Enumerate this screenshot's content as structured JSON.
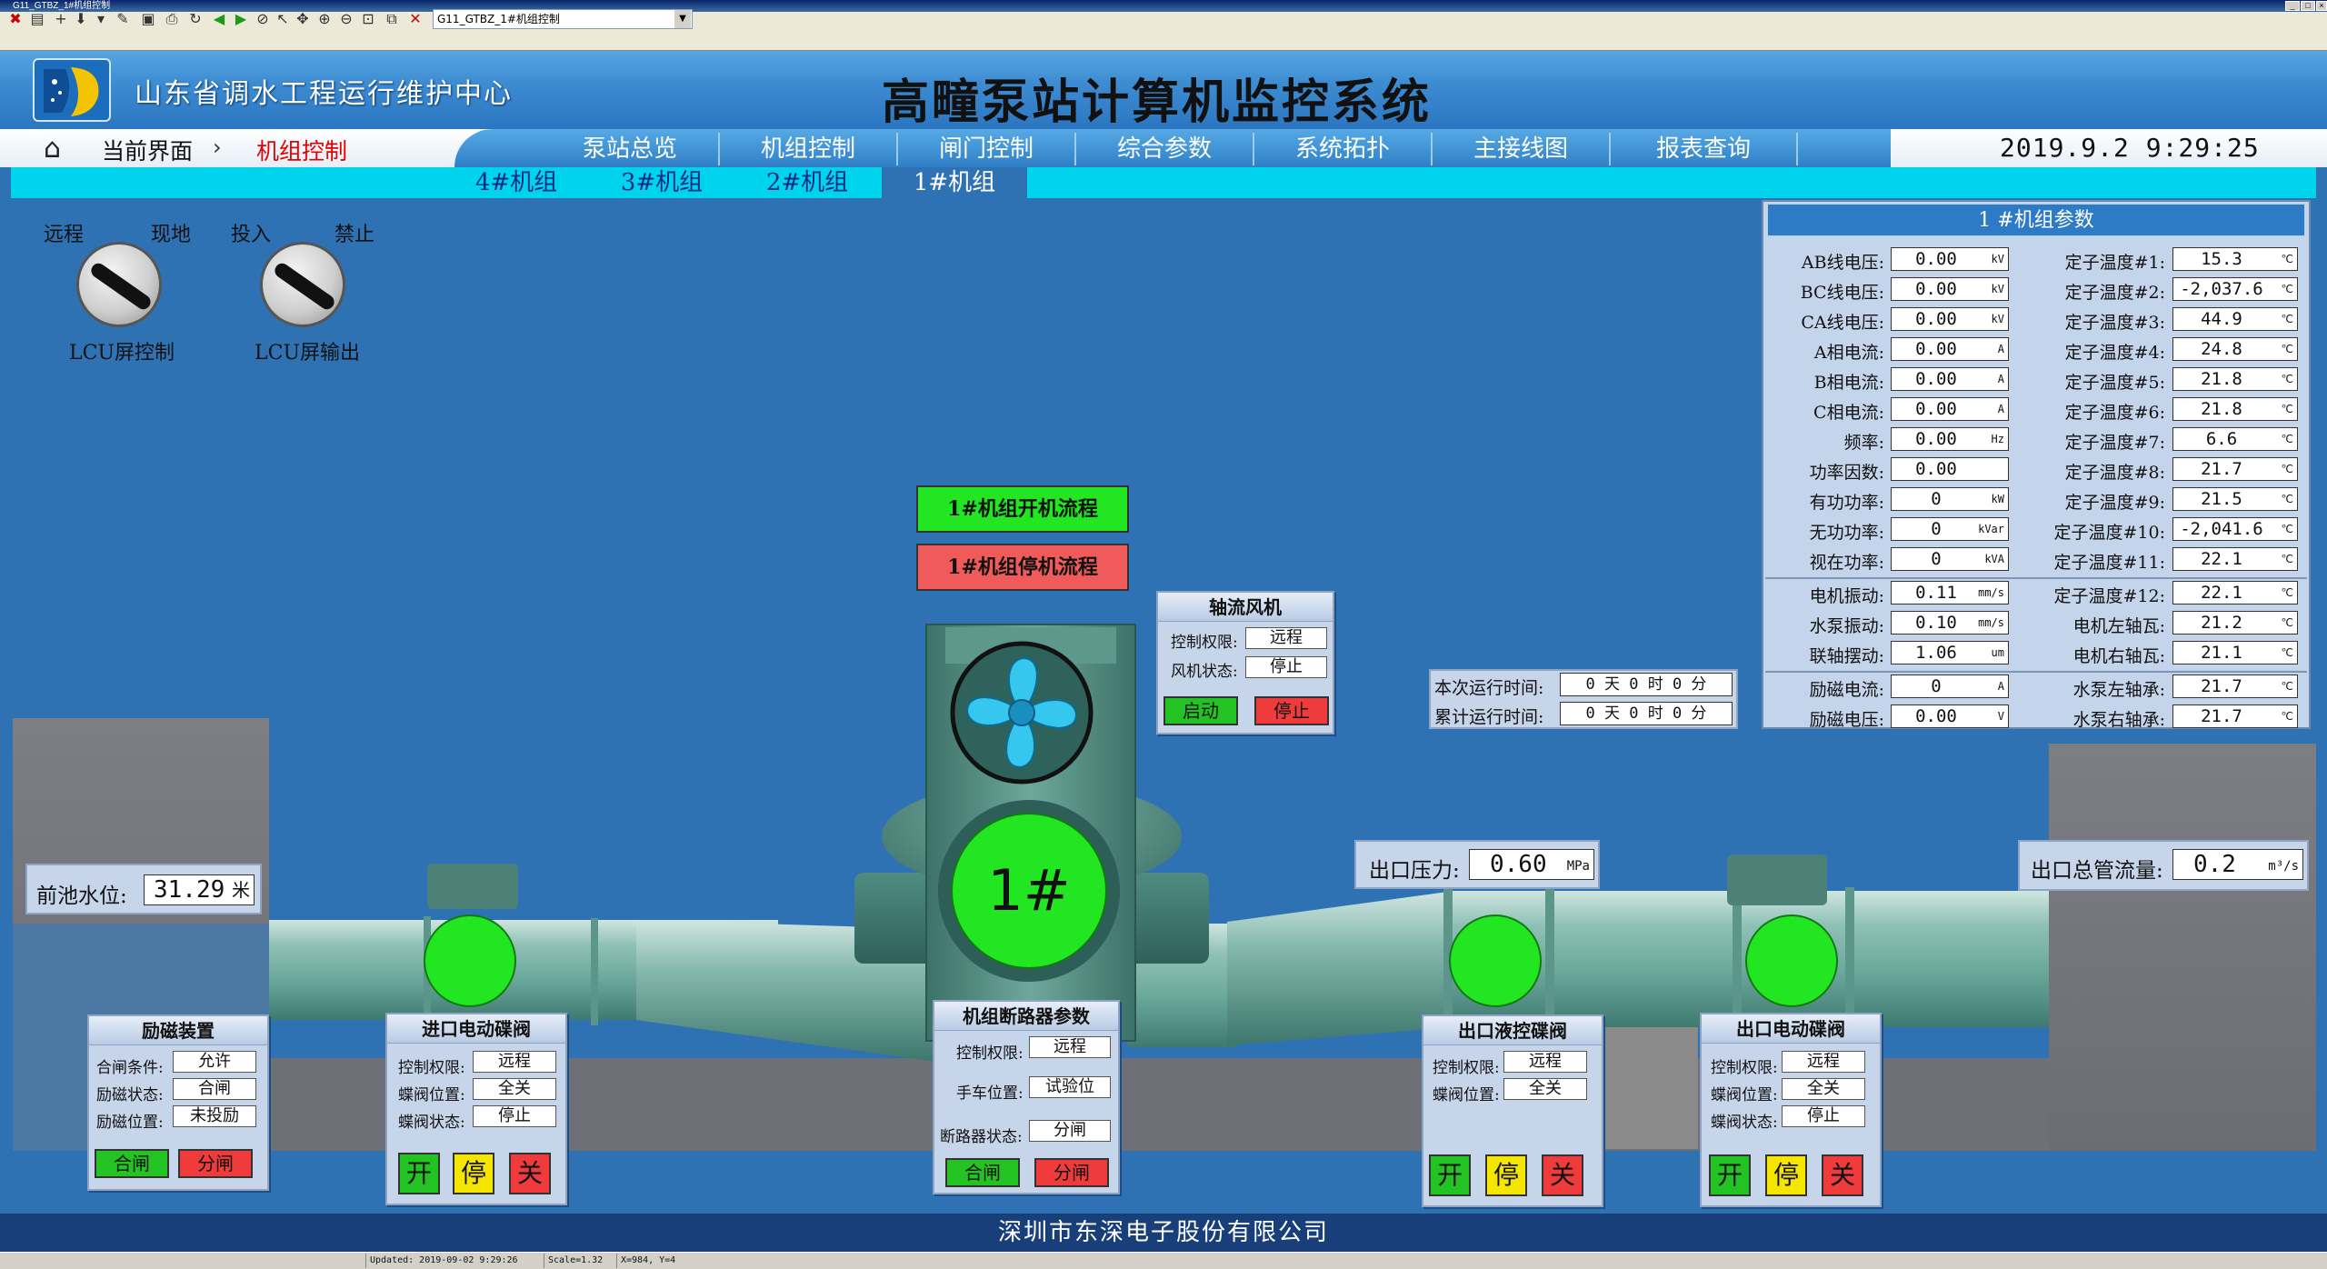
{
  "window": {
    "title": "G11_GTBZ_1#机组控制",
    "address": "G11_GTBZ_1#机组控制"
  },
  "header": {
    "org": "山东省调水工程运行维护中心",
    "system_title": "高疃泵站计算机监控系统"
  },
  "breadcrumb": {
    "current_label": "当前界面",
    "page": "机组控制"
  },
  "nav": {
    "items": [
      "泵站总览",
      "机组控制",
      "闸门控制",
      "综合参数",
      "系统拓扑",
      "主接线图",
      "报表查询"
    ]
  },
  "datetime": "2019.9.2  9:29:25",
  "unit_tabs": [
    "4#机组",
    "3#机组",
    "2#机组",
    "1#机组"
  ],
  "switches": {
    "lcu_control": {
      "left": "远程",
      "right": "现地",
      "caption": "LCU屏控制"
    },
    "lcu_output": {
      "left": "投入",
      "right": "禁止",
      "caption": "LCU屏输出"
    }
  },
  "flow": {
    "start": "1#机组开机流程",
    "stop": "1#机组停机流程"
  },
  "unit_label": "1#",
  "fan": {
    "title": "轴流风机",
    "auth_label": "控制权限:",
    "auth": "远程",
    "state_label": "风机状态:",
    "state": "停止",
    "start": "启动",
    "stop": "停止"
  },
  "runtime": {
    "current_label": "本次运行时间:",
    "current": "0 天 0 时 0 分",
    "total_label": "累计运行时间:",
    "total": "0 天 0 时 0 分"
  },
  "readouts": {
    "forebay": {
      "label": "前池水位:",
      "value": "31.29",
      "unit": "米"
    },
    "outlet_pressure": {
      "label": "出口压力:",
      "value": "0.60",
      "unit": "MPa"
    },
    "outlet_flow": {
      "label": "出口总管流量:",
      "value": "0.2",
      "unit": "m³/s"
    }
  },
  "excitation": {
    "title": "励磁装置",
    "rows": [
      {
        "label": "合闸条件:",
        "value": "允许"
      },
      {
        "label": "励磁状态:",
        "value": "合闸"
      },
      {
        "label": "励磁位置:",
        "value": "未投励"
      }
    ],
    "btn_close": "合闸",
    "btn_open": "分闸"
  },
  "inlet_valve": {
    "title": "进口电动碟阀",
    "rows": [
      {
        "label": "控制权限:",
        "value": "远程"
      },
      {
        "label": "蝶阀位置:",
        "value": "全关"
      },
      {
        "label": "蝶阀状态:",
        "value": "停止"
      }
    ],
    "btn_open": "开",
    "btn_stop": "停",
    "btn_close": "关"
  },
  "breaker": {
    "title": "机组断路器参数",
    "rows": [
      {
        "label": "控制权限:",
        "value": "远程"
      },
      {
        "label": "手车位置:",
        "value": "试验位"
      },
      {
        "label": "断路器状态:",
        "value": "分闸"
      }
    ],
    "btn_close": "合闸",
    "btn_open": "分闸"
  },
  "outlet_hyd_valve": {
    "title": "出口液控碟阀",
    "rows": [
      {
        "label": "控制权限:",
        "value": "远程"
      },
      {
        "label": "蝶阀位置:",
        "value": "全关"
      }
    ],
    "btn_open": "开",
    "btn_stop": "停",
    "btn_close": "关"
  },
  "outlet_elec_valve": {
    "title": "出口电动碟阀",
    "rows": [
      {
        "label": "控制权限:",
        "value": "远程"
      },
      {
        "label": "蝶阀位置:",
        "value": "全关"
      },
      {
        "label": "蝶阀状态:",
        "value": "停止"
      }
    ],
    "btn_open": "开",
    "btn_stop": "停",
    "btn_close": "关"
  },
  "params": {
    "title": "1 #机组参数",
    "left": [
      {
        "label": "AB线电压:",
        "value": "0.00",
        "unit": "kV"
      },
      {
        "label": "BC线电压:",
        "value": "0.00",
        "unit": "kV"
      },
      {
        "label": "CA线电压:",
        "value": "0.00",
        "unit": "kV"
      },
      {
        "label": "A相电流:",
        "value": "0.00",
        "unit": "A"
      },
      {
        "label": "B相电流:",
        "value": "0.00",
        "unit": "A"
      },
      {
        "label": "C相电流:",
        "value": "0.00",
        "unit": "A"
      },
      {
        "label": "频率:",
        "value": "0.00",
        "unit": "Hz"
      },
      {
        "label": "功率因数:",
        "value": "0.00",
        "unit": ""
      },
      {
        "label": "有功功率:",
        "value": "0",
        "unit": "kW"
      },
      {
        "label": "无功功率:",
        "value": "0",
        "unit": "kVar"
      },
      {
        "label": "视在功率:",
        "value": "0",
        "unit": "kVA"
      },
      {
        "label": "电机振动:",
        "value": "0.11",
        "unit": "mm/s"
      },
      {
        "label": "水泵振动:",
        "value": "0.10",
        "unit": "mm/s"
      },
      {
        "label": "联轴摆动:",
        "value": "1.06",
        "unit": "um"
      },
      {
        "label": "励磁电流:",
        "value": "0",
        "unit": "A"
      },
      {
        "label": "励磁电压:",
        "value": "0.00",
        "unit": "V"
      }
    ],
    "right": [
      {
        "label": "定子温度#1:",
        "value": "15.3",
        "unit": "℃"
      },
      {
        "label": "定子温度#2:",
        "value": "-2,037.6",
        "unit": "℃"
      },
      {
        "label": "定子温度#3:",
        "value": "44.9",
        "unit": "℃"
      },
      {
        "label": "定子温度#4:",
        "value": "24.8",
        "unit": "℃"
      },
      {
        "label": "定子温度#5:",
        "value": "21.8",
        "unit": "℃"
      },
      {
        "label": "定子温度#6:",
        "value": "21.8",
        "unit": "℃"
      },
      {
        "label": "定子温度#7:",
        "value": "6.6",
        "unit": "℃"
      },
      {
        "label": "定子温度#8:",
        "value": "21.7",
        "unit": "℃"
      },
      {
        "label": "定子温度#9:",
        "value": "21.5",
        "unit": "℃"
      },
      {
        "label": "定子温度#10:",
        "value": "-2,041.6",
        "unit": "℃"
      },
      {
        "label": "定子温度#11:",
        "value": "22.1",
        "unit": "℃"
      },
      {
        "label": "定子温度#12:",
        "value": "22.1",
        "unit": "℃"
      },
      {
        "label": "电机左轴瓦:",
        "value": "21.2",
        "unit": "℃"
      },
      {
        "label": "电机右轴瓦:",
        "value": "21.1",
        "unit": "℃"
      },
      {
        "label": "水泵左轴承:",
        "value": "21.7",
        "unit": "℃"
      },
      {
        "label": "水泵右轴承:",
        "value": "21.7",
        "unit": "℃"
      }
    ]
  },
  "footer": "深圳市东深电子股份有限公司",
  "status": {
    "updated": "Updated: 2019-09-02 9:29:26",
    "scale": "Scale=1.32",
    "pos": "X=984, Y=4"
  },
  "colors": {
    "running_indicator": "#22e622",
    "header_blue": "#2f72b4",
    "accent_cyan": "#00d4ec",
    "alarm_red": "#ef3b3b"
  }
}
